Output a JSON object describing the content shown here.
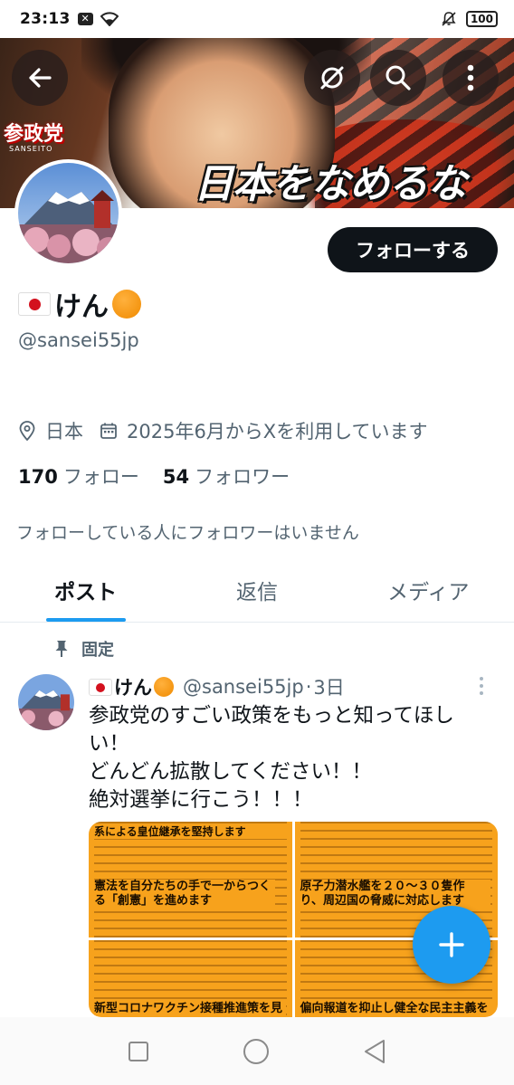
{
  "status_bar": {
    "time": "23:13",
    "battery": "100",
    "icons": [
      "x-notification-icon",
      "wifi-icon",
      "mute-icon",
      "battery-icon"
    ]
  },
  "banner": {
    "slogan": "日本をなめるな",
    "logo_text": "参政党",
    "logo_sub": "SANSEITO"
  },
  "header_actions": {
    "back_icon": "back-arrow-icon",
    "grok_icon": "slashed-circle-icon",
    "search_icon": "search-icon",
    "more_icon": "more-vertical-icon"
  },
  "profile": {
    "display_name": "けん",
    "handle": "@sansei55jp",
    "location": "日本",
    "joined": "2025年6月からXを利用しています",
    "following_count": "170",
    "following_label": "フォロー",
    "followers_count": "54",
    "followers_label": "フォロワー",
    "mutual_note": "フォローしている人にフォロワーはいません",
    "follow_button": "フォローする"
  },
  "tabs": [
    {
      "label": "ポスト",
      "active": true
    },
    {
      "label": "返信",
      "active": false
    },
    {
      "label": "メディア",
      "active": false
    }
  ],
  "pinned_post": {
    "pinned_label": "固定",
    "author_name": "けん",
    "author_handle": "@sansei55jp",
    "time": "3日",
    "text_lines": [
      "参政党のすごい政策をもっと知ってほし",
      "い！",
      "どんどん拡散してください！！",
      "絶対選挙に行こう！！！"
    ],
    "media": [
      {
        "head": "系による皇位継承を堅持します",
        "head2": "憲法を自分たちの手で一からつくる「創憲」を進めます"
      },
      {
        "head": "",
        "head2": "原子力潜水艦を２０～３０隻作り、周辺国の脅威に対応します"
      },
      {
        "head": "",
        "head2": "新型コロナワクチン接種推進策を見"
      },
      {
        "head": "",
        "head2": "偏向報道を抑止し健全な民主主義を"
      }
    ]
  },
  "colors": {
    "accent": "#1d9bf0",
    "text_primary": "#0f1419",
    "text_secondary": "#536471",
    "media_bg": "#f7a21c"
  }
}
